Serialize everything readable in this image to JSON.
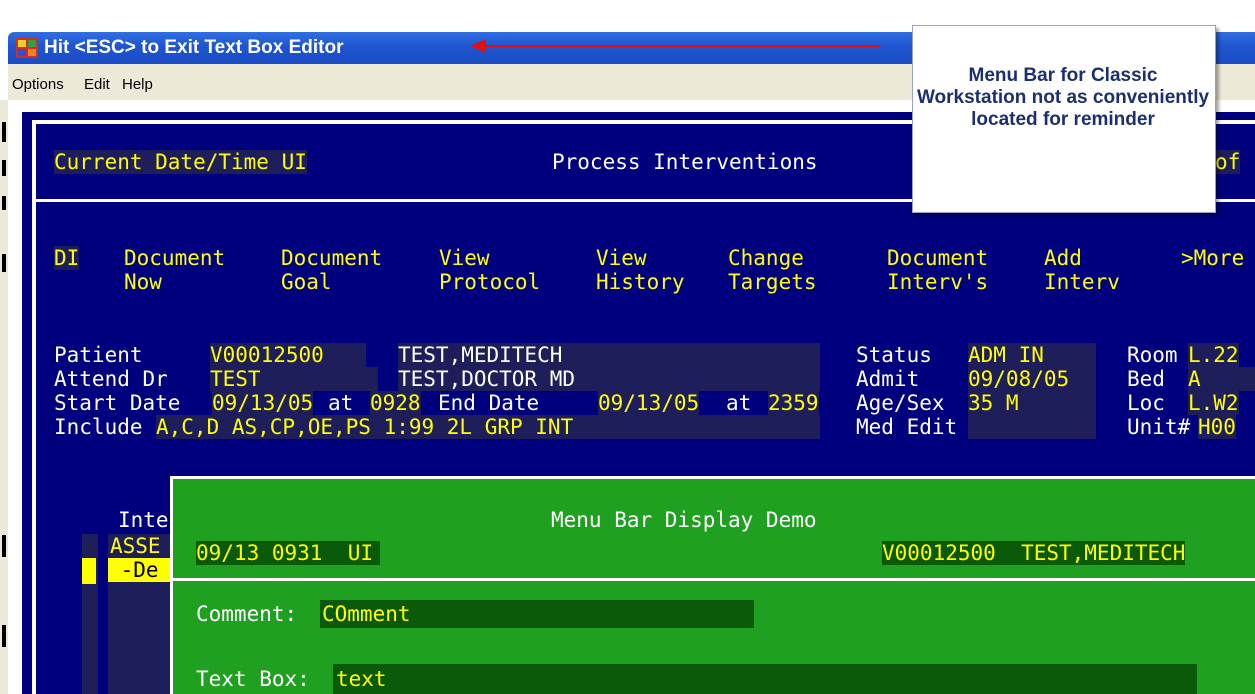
{
  "window": {
    "title": "Hit <ESC> to Exit Text Box Editor",
    "menu": [
      "Options",
      "Edit",
      "Help"
    ]
  },
  "callout": {
    "text": "Menu Bar for Classic Workstation not as conveniently located for reminder"
  },
  "header": {
    "left": "Current Date/Time UI",
    "center": "Process Interventions",
    "right_fragment": "of"
  },
  "actions": [
    {
      "l1": "DI",
      "l2": ""
    },
    {
      "l1": "Document",
      "l2": "Now"
    },
    {
      "l1": "Document",
      "l2": "Goal"
    },
    {
      "l1": "View",
      "l2": "Protocol"
    },
    {
      "l1": "View",
      "l2": "History"
    },
    {
      "l1": "Change",
      "l2": "Targets"
    },
    {
      "l1": "Document",
      "l2": "Interv's"
    },
    {
      "l1": "Add",
      "l2": "Interv"
    },
    {
      "l1": ">More",
      "l2": ""
    }
  ],
  "patient": {
    "patient_label": "Patient",
    "patient_id": "V00012500",
    "patient_name": "TEST,MEDITECH",
    "attend_label": "Attend Dr",
    "attend_code": "TEST",
    "attend_name": "TEST,DOCTOR MD",
    "start_label": "Start Date",
    "start_date": "09/13/05",
    "at1": "at",
    "start_time": "0928",
    "end_label": "End Date",
    "end_date": "09/13/05",
    "at2": "at",
    "end_time": "2359",
    "include_label": "Include",
    "include_value": "A,C,D AS,CP,OE,PS 1:99 2L GRP INT",
    "status_label": "Status",
    "status_value": "ADM IN",
    "admit_label": "Admit",
    "admit_value": "09/08/05",
    "agesex_label": "Age/Sex",
    "agesex_value": "35 M",
    "mededit_label": "Med Edit",
    "room_label": "Room",
    "room_value": "L.22",
    "bed_label": "Bed",
    "bed_value": "A",
    "loc_label": "Loc",
    "loc_value": "L.W2",
    "unit_label": "Unit#",
    "unit_value": "H00"
  },
  "list": {
    "header_fragment": "Inte",
    "row1_fragment": "ASSE",
    "row2_fragment": " -De"
  },
  "dialog": {
    "title": "Menu Bar Display Demo",
    "datetime": "09/13 0931  UI",
    "patient": "V00012500  TEST,MEDITECH",
    "comment_label": "Comment:",
    "comment_value": "COmment",
    "textbox_label": "Text Box:",
    "textbox_value": "text"
  }
}
